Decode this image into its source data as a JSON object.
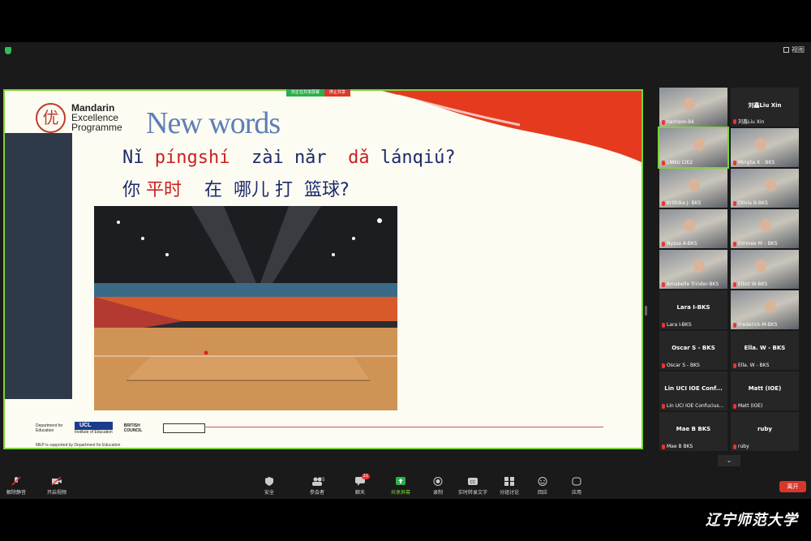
{
  "topbar": {
    "view_label": "视图"
  },
  "share_banner": {
    "label_green": "你正在共享屏幕",
    "label_red": "停止共享"
  },
  "slide": {
    "logo_char": "优",
    "brand_line1": "Mandarin",
    "brand_line2": "Excellence",
    "brand_line3": "Programme",
    "headline": "New words",
    "pinyin": {
      "p1": "Nǐ ",
      "p2": "píngshí",
      "p3": "  zài nǎr  ",
      "p4": "dǎ",
      "p5": " lánqiú?"
    },
    "hanzi": {
      "h1": "你 ",
      "h2": "平时",
      "h3": "    在  哪儿 打  篮球?"
    },
    "footer": {
      "dfe": "Department for Education",
      "ucl": "UCL",
      "ucl_sub": "Institute of Education",
      "bc": "BRITISH COUNCIL",
      "note": "MEP is supported by Department for Education"
    }
  },
  "gallery": {
    "tiles": [
      {
        "label": "harrison-bk",
        "big": ""
      },
      {
        "label": "刘鑫Liu Xin",
        "big": "刘鑫Liu Xin"
      },
      {
        "label": "LNNU CIE2",
        "big": ""
      },
      {
        "label": "Minglia K - BKS",
        "big": ""
      },
      {
        "label": "Krithika J- BKS",
        "big": ""
      },
      {
        "label": "Olivia B-BKS",
        "big": ""
      },
      {
        "label": "Nyssa A-BKS",
        "big": ""
      },
      {
        "label": "Emmee M – BKS",
        "big": ""
      },
      {
        "label": "Amabelle Trinder-BKS",
        "big": ""
      },
      {
        "label": "Elliot W-BKS",
        "big": ""
      },
      {
        "label": "Lara I-BKS",
        "big": "Lara I-BKS"
      },
      {
        "label": "Frederick-M-BKS",
        "big": ""
      },
      {
        "label": "Oscar S - BKS",
        "big": "Oscar S - BKS"
      },
      {
        "label": "Ella. W - BKS",
        "big": "Ella. W - BKS"
      },
      {
        "label": "Lin UCI IOE Confucius...",
        "big": "Lin UCI IOE Conf..."
      },
      {
        "label": "Matt (IOE)",
        "big": "Matt (IOE)"
      },
      {
        "label": "Mae B BKS",
        "big": "Mae B BKS"
      },
      {
        "label": "ruby",
        "big": "ruby"
      }
    ]
  },
  "toolbar": {
    "unmute": "解除静音",
    "video": "开启视频",
    "security": "安全",
    "participants": "参会者",
    "participants_count": "25",
    "chat": "聊天",
    "chat_badge": "21",
    "share": "共享屏幕",
    "record": "录制",
    "captions": "实时转录文字",
    "breakout": "分组讨论",
    "reactions": "回应",
    "apps": "应用",
    "leave": "离开"
  },
  "watermark": "辽宁师范大学",
  "colors": {
    "accent_green": "#7fd23b",
    "leave_red": "#d9362b",
    "slide_red": "#cc1f1f",
    "headline_blue": "#5d7eb8"
  }
}
